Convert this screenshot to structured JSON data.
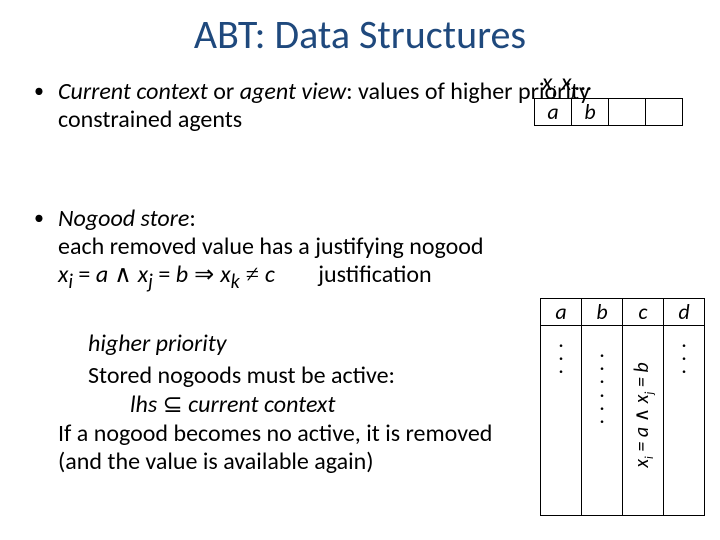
{
  "title": "ABT: Data Structures",
  "bullet_mark": "•",
  "bullet1": {
    "current_context_label": "Current context",
    "sep1": " or ",
    "agent_view_label": "agent view",
    "rest": ": values of higher priority constrained agents"
  },
  "agent_view": {
    "labels": [
      "x",
      "i",
      " ",
      "x",
      "j",
      "…"
    ],
    "cells": [
      "a",
      "b",
      "",
      ""
    ]
  },
  "bullet2": {
    "nogood_label": "Nogood store",
    "line2": "each removed value has a justifying nogood",
    "formula_xi": "x",
    "formula_i": "i",
    "eq": " = ",
    "a": "a",
    "and": " ∧ ",
    "xj": "x",
    "j": "j",
    "b": "b",
    "imp": " ⇒ ",
    "xk": "x",
    "k": "k",
    "neq": " ≠ ",
    "c": "c",
    "justif": "justification"
  },
  "ns_table": {
    "headers": [
      "a",
      "b",
      "c",
      "d"
    ],
    "dots_short": [
      ".",
      ".",
      "."
    ],
    "dots_long": [
      ".",
      ".",
      ".",
      ".",
      ".",
      "."
    ],
    "col3_label_xi": "x",
    "col3_label_i": "i",
    "col3_label_eq": " = a ",
    "col3_label_and": "∧",
    "col3_label_xj": " x",
    "col3_label_j": "j",
    "col3_label_eqb": " = b"
  },
  "higher_priority_text": "higher priority",
  "stored_line": "Stored nogoods must be active:",
  "lhs_line": {
    "lhs": "lhs ",
    "subset": "⊆",
    "rest": " current context"
  },
  "noactive_line1": "If a nogood becomes no active, it is removed",
  "noactive_line2": "(and the value is available again)"
}
